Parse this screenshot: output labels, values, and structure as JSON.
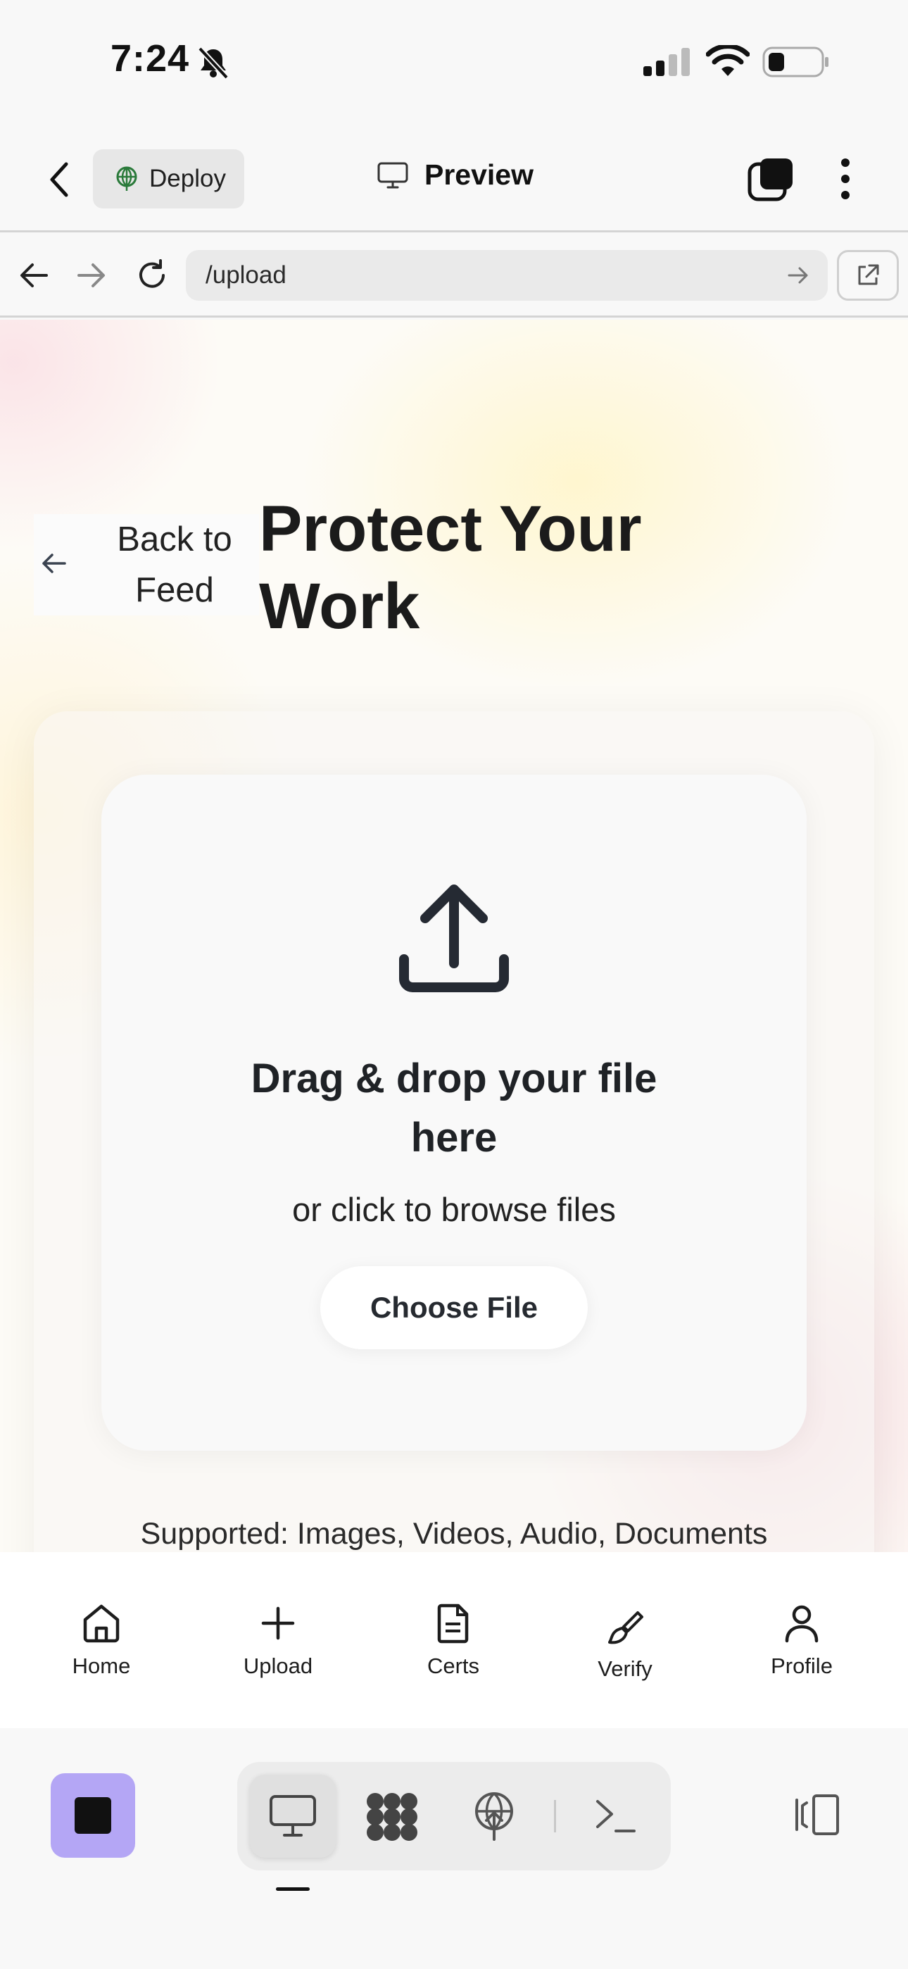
{
  "status_bar": {
    "time": "7:24"
  },
  "app_header": {
    "deploy_label": "Deploy",
    "preview_label": "Preview"
  },
  "browser": {
    "url": "/upload"
  },
  "page": {
    "back_label": "Back to\nFeed",
    "title": "Protect Your Work",
    "dropzone": {
      "title": "Drag & drop your file\nhere",
      "subtitle": "or click to browse files",
      "button": "Choose File"
    },
    "supported": "Supported: Images, Videos, Audio, Documents"
  },
  "tab_bar": {
    "items": [
      {
        "label": "Home",
        "icon": "home-icon"
      },
      {
        "label": "Upload",
        "icon": "plus-icon"
      },
      {
        "label": "Certs",
        "icon": "document-icon"
      },
      {
        "label": "Verify",
        "icon": "brush-icon"
      },
      {
        "label": "Profile",
        "icon": "user-icon"
      }
    ]
  },
  "colors": {
    "accent": "#b4a6f5",
    "text": "#1b1b1b"
  }
}
